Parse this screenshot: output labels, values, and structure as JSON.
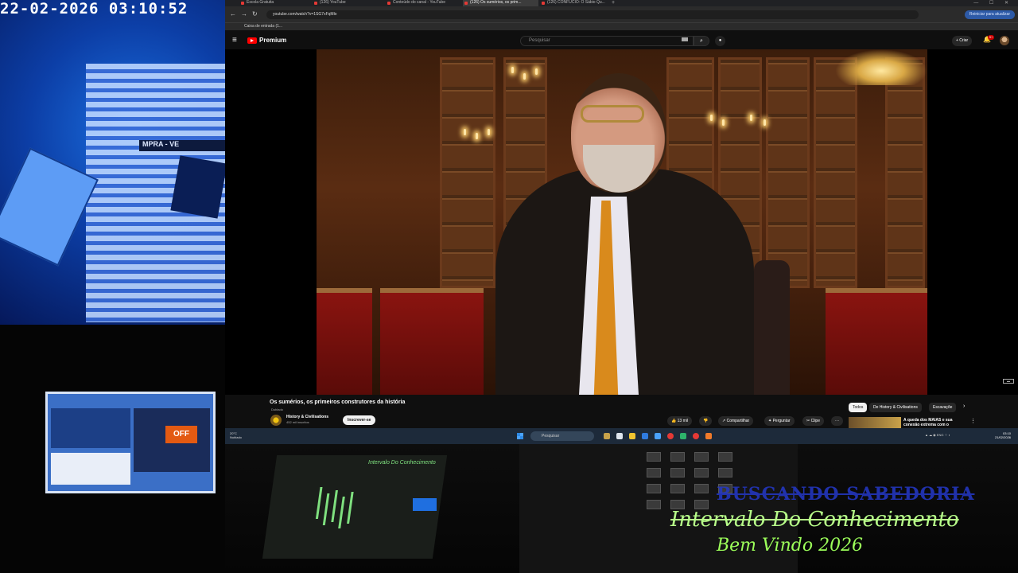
{
  "camera": {
    "timestamp": "22-02-2026 03:10:52",
    "sign_text": "MPRA - VE"
  },
  "browser": {
    "tabs": [
      {
        "label": "Escola Gratuita",
        "active": false
      },
      {
        "label": "(126) YouTube",
        "active": false
      },
      {
        "label": "Conteúdo do canal - YouTube",
        "active": false
      },
      {
        "label": "(126) Os sumérios, os prim...",
        "active": true
      },
      {
        "label": "(126) CONFUCIO: O Sábio Qu...",
        "active": false
      }
    ],
    "new_tab": "+",
    "window_controls": "— ☐ ✕",
    "url": "youtube.com/watch?v=1SG7xFqMlo",
    "update_button": "Reiniciar para atualizar",
    "bookmark": "Caixa de entrada (1..."
  },
  "youtube": {
    "logo_text": "Premium",
    "search_placeholder": "Pesquisar",
    "create_label": "+ Criar",
    "notification_count": "9+",
    "video": {
      "title": "Os sumérios, os primeiros construtores da história",
      "badge": "Dublado",
      "channel": "History & Civilisations",
      "subscribers": "452 mil inscritos",
      "subscribe_label": "Inscrever-se",
      "likes": "13 mil",
      "share_label": "Compartilhar",
      "ask_label": "Perguntar",
      "clip_label": "Clipe",
      "more_label": "···"
    },
    "chips": [
      {
        "label": "Todos",
        "active": true
      },
      {
        "label": "De History & Civilisations",
        "active": false
      },
      {
        "label": "Escavaçõe",
        "active": false
      }
    ],
    "recommendation_title": "A queda dos MAIAS e sua conexão extrema com o"
  },
  "taskbar": {
    "weather_temp": "20°C",
    "weather_text": "Nublado",
    "search_placeholder": "Pesquisar",
    "tray_text": "ENG",
    "time": "03:10",
    "date": "21/02/2026"
  },
  "overlay": {
    "title": "BUSCANDO SABEDORIA",
    "subtitle": "Intervalo Do Conhecimento",
    "welcome": "Bem Vindo 2026"
  },
  "mini_monitor": {
    "label": "OFF"
  },
  "mixer": {
    "label": "Intervalo Do Conhecimento"
  },
  "colors": {
    "youtube_red": "#ff0000",
    "overlay_blue": "#2438c8",
    "overlay_green": "#9cff5a"
  }
}
